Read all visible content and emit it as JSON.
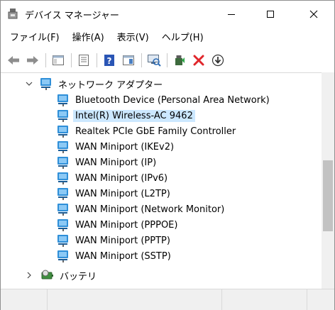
{
  "window": {
    "title": "デバイス マネージャー",
    "app_icon": "device-manager-icon"
  },
  "menu": [
    {
      "label": "ファイル(F)"
    },
    {
      "label": "操作(A)"
    },
    {
      "label": "表示(V)"
    },
    {
      "label": "ヘルプ(H)"
    }
  ],
  "toolbar": [
    {
      "icon": "back-arrow-icon"
    },
    {
      "icon": "forward-arrow-icon"
    },
    {
      "icon": "console-tree-icon"
    },
    {
      "icon": "properties-icon"
    },
    {
      "icon": "help-icon"
    },
    {
      "icon": "view-icon"
    },
    {
      "icon": "scan-hardware-icon"
    },
    {
      "icon": "update-driver-icon"
    },
    {
      "icon": "uninstall-icon"
    },
    {
      "icon": "disable-device-icon"
    }
  ],
  "tree": {
    "category_network": "ネットワーク アダプター",
    "devices": [
      {
        "label": "Bluetooth Device (Personal Area Network)"
      },
      {
        "label": "Intel(R) Wireless-AC 9462",
        "selected": true
      },
      {
        "label": "Realtek PCIe GbE Family Controller"
      },
      {
        "label": "WAN Miniport (IKEv2)"
      },
      {
        "label": "WAN Miniport (IP)"
      },
      {
        "label": "WAN Miniport (IPv6)"
      },
      {
        "label": "WAN Miniport (L2TP)"
      },
      {
        "label": "WAN Miniport (Network Monitor)"
      },
      {
        "label": "WAN Miniport (PPPOE)"
      },
      {
        "label": "WAN Miniport (PPTP)"
      },
      {
        "label": "WAN Miniport (SSTP)"
      }
    ],
    "category_battery": "バッテリ"
  },
  "colors": {
    "selection": "#cce8ff",
    "network_icon": "#2f8fd8",
    "uninstall_red": "#e0262b"
  }
}
